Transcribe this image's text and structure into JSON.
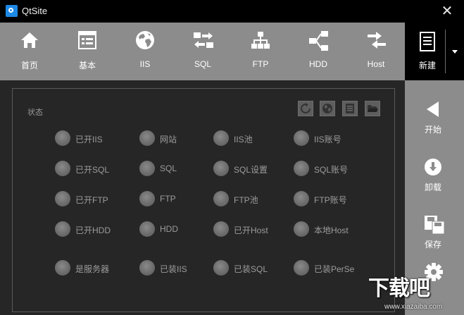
{
  "window": {
    "title": "QtSite",
    "close_glyph": "✕"
  },
  "toolbar": {
    "items": [
      {
        "label": "首页",
        "icon": "home-icon"
      },
      {
        "label": "基本",
        "icon": "basic-settings-icon"
      },
      {
        "label": "IIS",
        "icon": "globe-icon"
      },
      {
        "label": "SQL",
        "icon": "sql-transfer-icon"
      },
      {
        "label": "FTP",
        "icon": "network-tree-icon"
      },
      {
        "label": "HDD",
        "icon": "disk-share-icon"
      },
      {
        "label": "Host",
        "icon": "host-arrows-icon"
      }
    ],
    "new_label": "新建"
  },
  "status": {
    "title": "状态",
    "actions": [
      "refresh-icon",
      "globe-icon",
      "list-icon",
      "folder-open-icon"
    ],
    "rows": [
      [
        "已开IIS",
        "网站",
        "IIS池",
        "IIS账号"
      ],
      [
        "已开SQL",
        "SQL",
        "SQL设置",
        "SQL账号"
      ],
      [
        "已开FTP",
        "FTP",
        "FTP池",
        "FTP账号"
      ],
      [
        "已开HDD",
        "HDD",
        "已开Host",
        "本地Host"
      ],
      [
        "是服务器",
        "已装IIS",
        "已装SQL",
        "已装PerSe"
      ]
    ]
  },
  "sidebar": {
    "items": [
      {
        "label": "开始",
        "icon": "play-left-icon"
      },
      {
        "label": "卸载",
        "icon": "download-circle-icon"
      },
      {
        "label": "保存",
        "icon": "save-icon"
      },
      {
        "label": "",
        "icon": "gear-icon"
      }
    ]
  },
  "watermark": {
    "text": "下载吧",
    "url": "www.xiazaiba.com"
  },
  "colors": {
    "toolbar_bg": "#8c8c8c",
    "panel_bg": "#262626",
    "titlebar_bg": "#000000",
    "indicator_off": "#6c6c6c"
  }
}
